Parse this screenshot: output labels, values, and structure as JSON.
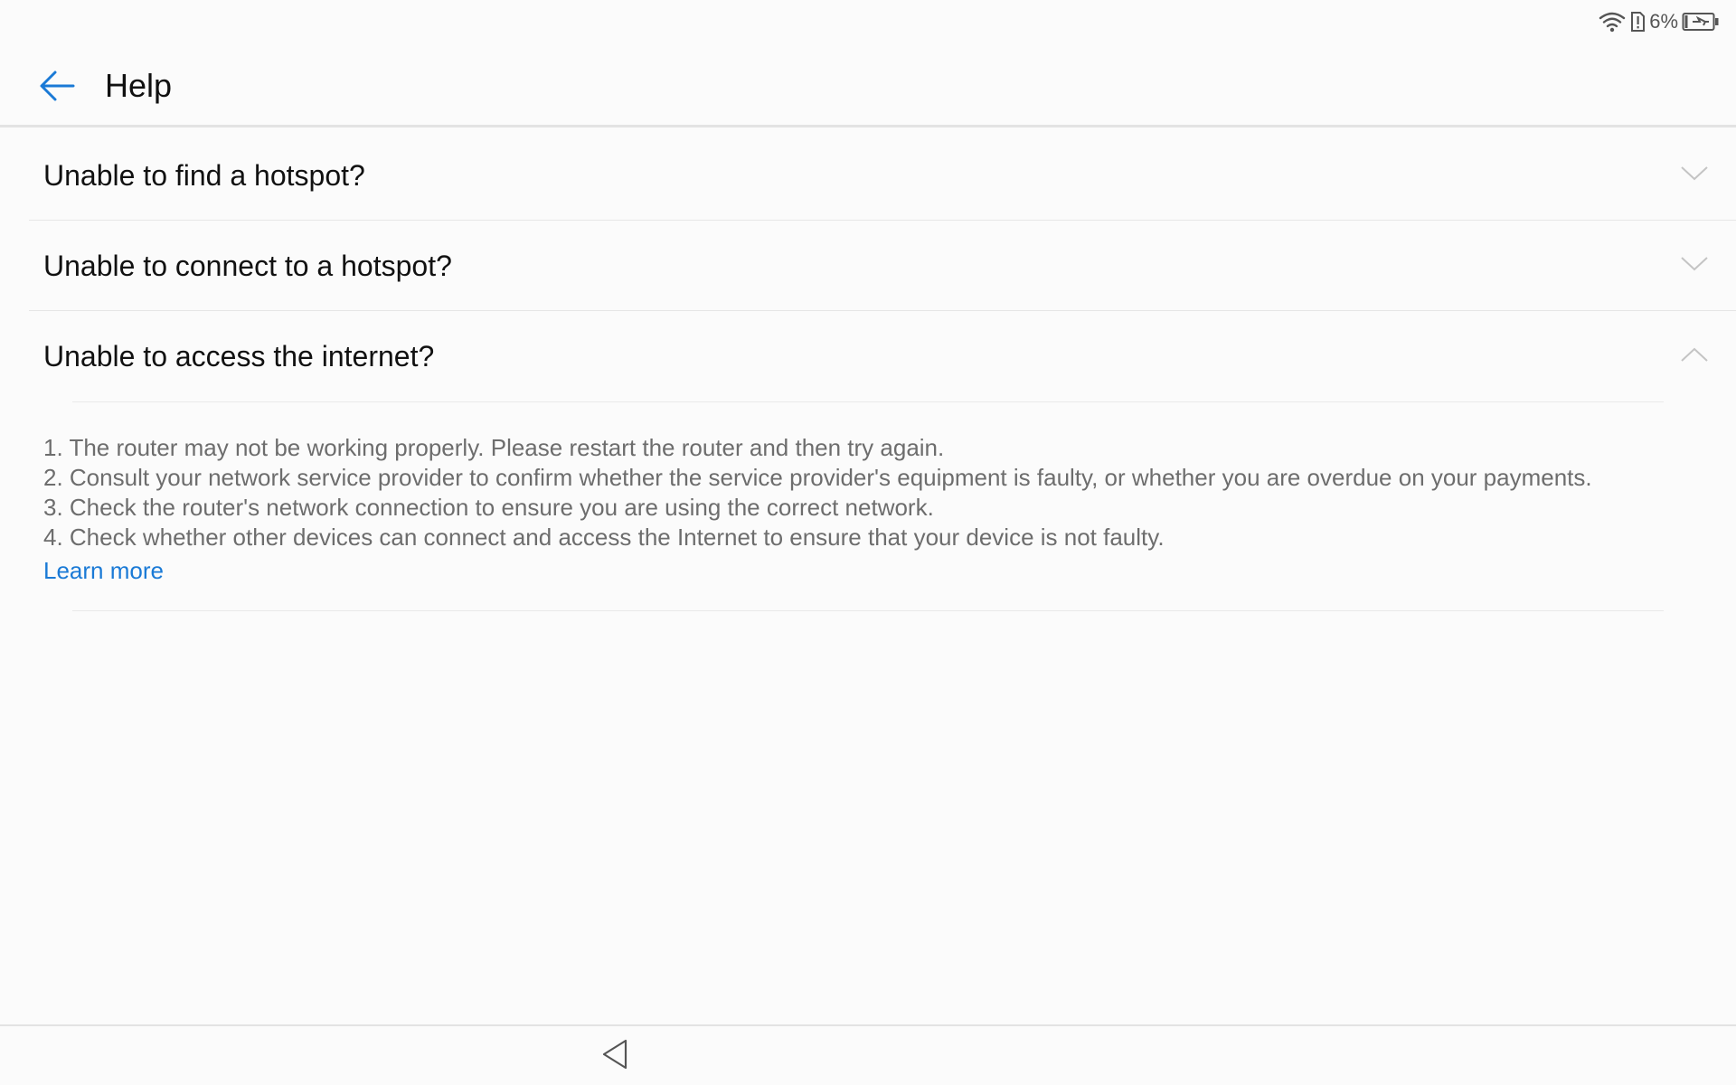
{
  "status_bar": {
    "battery_percent": "6%",
    "icons": [
      "wifi-icon",
      "sim-alert-icon",
      "battery-charging-icon"
    ]
  },
  "header": {
    "title": "Help",
    "back_icon": "arrow-left-icon"
  },
  "faq": {
    "items": [
      {
        "question": "Unable to find a hotspot?",
        "expanded": false
      },
      {
        "question": "Unable to connect to a hotspot?",
        "expanded": false
      },
      {
        "question": "Unable to access the internet?",
        "expanded": true,
        "answer_lines": [
          "1. The router may not be working properly. Please restart the router and then try again.",
          "2. Consult your network service provider to confirm whether the service provider's equipment is faulty, or whether you are overdue on your payments.",
          "3. Check the router's network connection to ensure you are using the correct network.",
          "4. Check whether other devices can connect and access the Internet to ensure that your device is not faulty."
        ],
        "link": "Learn more"
      }
    ]
  },
  "colors": {
    "accent": "#1a7ad6",
    "background": "#fbfbfb",
    "answer_text": "#6d6d6d"
  },
  "navigation_bar": {
    "back_icon": "triangle-back-icon"
  }
}
